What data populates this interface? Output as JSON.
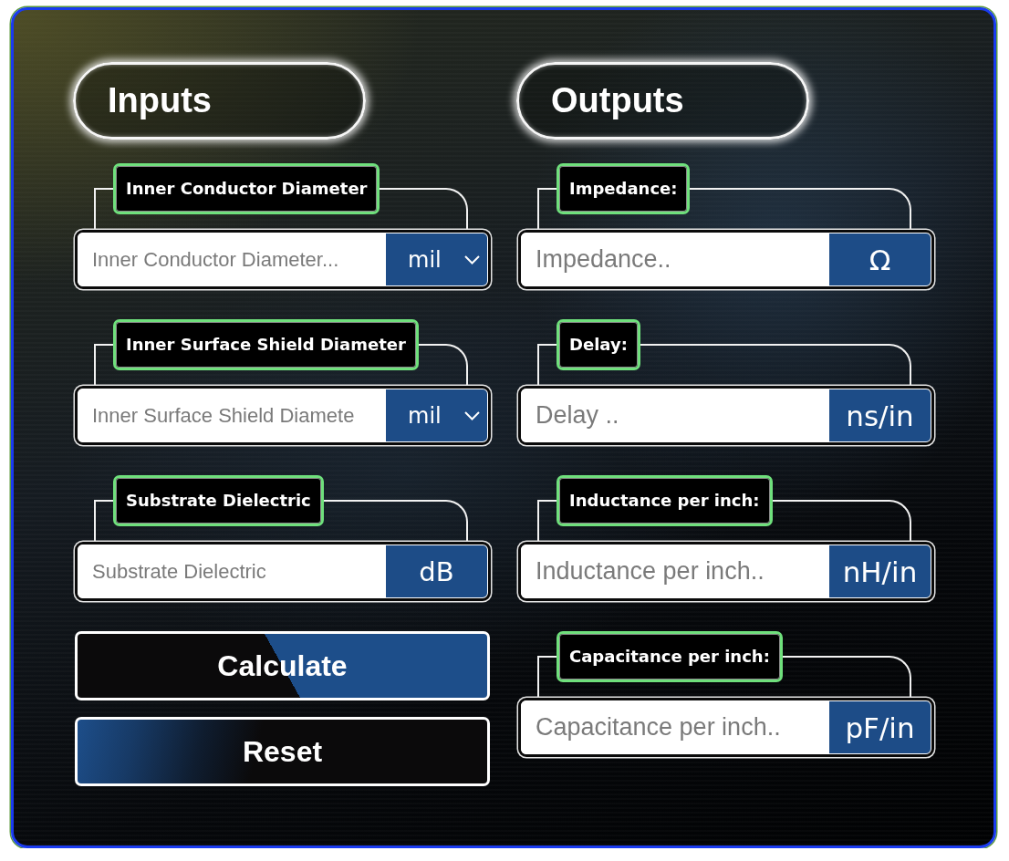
{
  "inputs": {
    "title": "Inputs",
    "fields": [
      {
        "label": "Inner Conductor Diameter",
        "placeholder": "Inner Conductor Diameter...",
        "unit": "mil",
        "kind": "select"
      },
      {
        "label": "Inner Surface Shield Diameter",
        "placeholder": "Inner Surface Shield Diamete",
        "unit": "mil",
        "kind": "select"
      },
      {
        "label": "Substrate Dielectric",
        "placeholder": "Substrate Dielectric",
        "unit": "dB",
        "kind": "fixed"
      }
    ],
    "buttons": [
      {
        "label": "Calculate",
        "kind": "split"
      },
      {
        "label": "Reset",
        "kind": "fade"
      }
    ]
  },
  "outputs": {
    "title": "Outputs",
    "fields": [
      {
        "label": "Impedance:",
        "placeholder": "Impedance..",
        "unit": "Ω",
        "kind": "fixed"
      },
      {
        "label": "Delay:",
        "placeholder": "Delay ..",
        "unit": "ns/in",
        "kind": "fixed"
      },
      {
        "label": "Inductance per inch:",
        "placeholder": "Inductance per inch..",
        "unit": "nH/in",
        "kind": "fixed"
      },
      {
        "label": "Capacitance per inch:",
        "placeholder": "Capacitance per inch..",
        "unit": "pF/in",
        "kind": "fixed"
      }
    ]
  }
}
